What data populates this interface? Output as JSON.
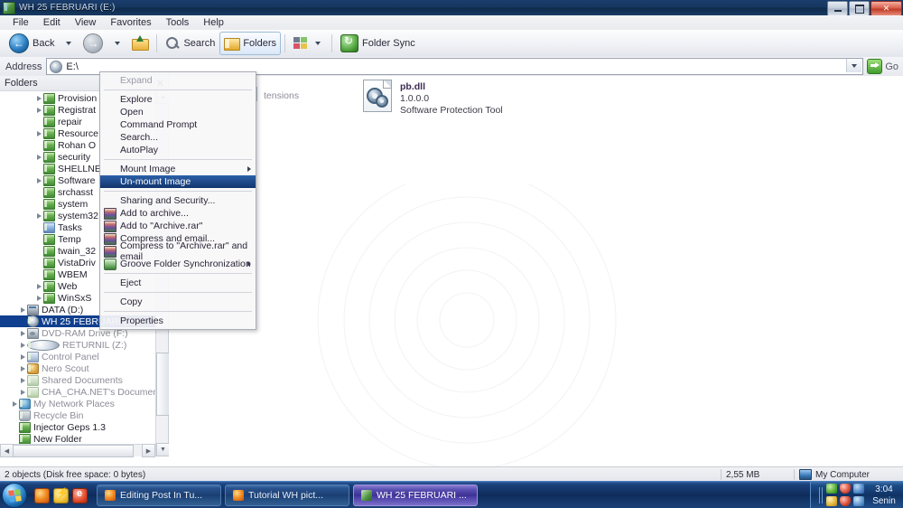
{
  "window": {
    "title": "WH 25 FEBRUARI (E:)",
    "icon": "drive-folder-icon",
    "minimize": "–",
    "maximize": "□",
    "close": "✕"
  },
  "menubar": {
    "items": [
      {
        "label": "File"
      },
      {
        "label": "Edit"
      },
      {
        "label": "View"
      },
      {
        "label": "Favorites"
      },
      {
        "label": "Tools"
      },
      {
        "label": "Help"
      }
    ]
  },
  "toolbar": {
    "back_label": "Back",
    "search_label": "Search",
    "folders_label": "Folders",
    "folder_sync_label": "Folder Sync"
  },
  "address": {
    "label": "Address",
    "value": "E:\\",
    "go_label": "Go"
  },
  "folders_pane": {
    "header": "Folders",
    "close_glyph": "✕",
    "items": [
      {
        "label": "Provision",
        "indent": 4,
        "twisty": true,
        "icon": "folder-icon",
        "dim": false
      },
      {
        "label": "Registrat",
        "indent": 4,
        "twisty": true,
        "icon": "folder-icon",
        "dim": false
      },
      {
        "label": "repair",
        "indent": 4,
        "twisty": false,
        "icon": "folder-icon",
        "dim": false
      },
      {
        "label": "Resource",
        "indent": 4,
        "twisty": true,
        "icon": "folder-icon",
        "dim": false
      },
      {
        "label": "Rohan O",
        "indent": 4,
        "twisty": false,
        "icon": "folder-icon",
        "dim": false
      },
      {
        "label": "security",
        "indent": 4,
        "twisty": true,
        "icon": "folder-icon",
        "dim": false
      },
      {
        "label": "SHELLNE",
        "indent": 4,
        "twisty": false,
        "icon": "folder-icon",
        "dim": false
      },
      {
        "label": "Software",
        "indent": 4,
        "twisty": true,
        "icon": "folder-icon",
        "dim": false
      },
      {
        "label": "srchasst",
        "indent": 4,
        "twisty": false,
        "icon": "folder-icon",
        "dim": false
      },
      {
        "label": "system",
        "indent": 4,
        "twisty": false,
        "icon": "folder-icon",
        "dim": false
      },
      {
        "label": "system32",
        "indent": 4,
        "twisty": true,
        "icon": "folder-icon",
        "dim": false
      },
      {
        "label": "Tasks",
        "indent": 4,
        "twisty": false,
        "icon": "folder-blue-icon",
        "dim": false
      },
      {
        "label": "Temp",
        "indent": 4,
        "twisty": false,
        "icon": "folder-icon",
        "dim": false
      },
      {
        "label": "twain_32",
        "indent": 4,
        "twisty": false,
        "icon": "folder-icon",
        "dim": false
      },
      {
        "label": "VistaDriv",
        "indent": 4,
        "twisty": false,
        "icon": "folder-icon",
        "dim": false
      },
      {
        "label": "WBEM",
        "indent": 4,
        "twisty": false,
        "icon": "folder-icon",
        "dim": false
      },
      {
        "label": "Web",
        "indent": 4,
        "twisty": true,
        "icon": "folder-icon",
        "dim": false
      },
      {
        "label": "WinSxS",
        "indent": 4,
        "twisty": true,
        "icon": "folder-icon",
        "dim": false
      },
      {
        "label": "DATA (D:)",
        "indent": 2,
        "twisty": true,
        "icon": "hard-drive-icon",
        "dim": false
      },
      {
        "label": "WH 25 FEBRUARI (E:)",
        "indent": 2,
        "twisty": false,
        "icon": "disc-drive-icon",
        "dim": false,
        "selected": true
      },
      {
        "label": "DVD-RAM Drive (F:)",
        "indent": 2,
        "twisty": true,
        "icon": "dvd-drive-icon",
        "dim": true
      },
      {
        "label": "RETURNIL (Z:)",
        "indent": 2,
        "twisty": true,
        "icon": "clock-drive-icon",
        "dim": true
      },
      {
        "label": "Control Panel",
        "indent": 2,
        "twisty": true,
        "icon": "control-panel-icon",
        "dim": true
      },
      {
        "label": "Nero Scout",
        "indent": 2,
        "twisty": true,
        "icon": "nero-scout-icon",
        "dim": true
      },
      {
        "label": "Shared Documents",
        "indent": 2,
        "twisty": true,
        "icon": "folder-pale-icon",
        "dim": true
      },
      {
        "label": "CHA_CHA.NET's Documents",
        "indent": 2,
        "twisty": true,
        "icon": "folder-pale-icon",
        "dim": true
      },
      {
        "label": "My Network Places",
        "indent": 1,
        "twisty": true,
        "icon": "network-icon",
        "dim": true
      },
      {
        "label": "Recycle Bin",
        "indent": 1,
        "twisty": false,
        "icon": "recycle-bin-icon",
        "dim": true
      },
      {
        "label": "Injector Geps 1.3",
        "indent": 1,
        "twisty": false,
        "icon": "folder-icon",
        "dim": false
      },
      {
        "label": "New Folder",
        "indent": 1,
        "twisty": false,
        "icon": "folder-icon",
        "dim": false
      }
    ]
  },
  "content": {
    "column_header_partial": "tensions",
    "file": {
      "name": "pb.dll",
      "version": "1.0.0.0",
      "description": "Software Protection Tool",
      "icon": "dll-gear-icon"
    }
  },
  "context_menu": {
    "items": [
      {
        "label": "Expand",
        "state": "disabled"
      },
      {
        "type": "separator"
      },
      {
        "label": "Explore",
        "state": "normal"
      },
      {
        "label": "Open",
        "state": "normal"
      },
      {
        "label": "Command Prompt",
        "state": "normal"
      },
      {
        "label": "Search...",
        "state": "normal"
      },
      {
        "label": "AutoPlay",
        "state": "normal"
      },
      {
        "type": "separator"
      },
      {
        "label": "Mount Image",
        "state": "normal",
        "submenu": true
      },
      {
        "label": "Un-mount Image",
        "state": "highlight"
      },
      {
        "type": "separator"
      },
      {
        "label": "Sharing and Security...",
        "state": "normal"
      },
      {
        "label": "Add to archive...",
        "state": "normal",
        "icon": "winrar-icon"
      },
      {
        "label": "Add to \"Archive.rar\"",
        "state": "normal",
        "icon": "winrar-icon"
      },
      {
        "label": "Compress and email...",
        "state": "normal",
        "icon": "winrar-icon"
      },
      {
        "label": "Compress to \"Archive.rar\" and email",
        "state": "normal",
        "icon": "winrar-icon"
      },
      {
        "label": "Groove Folder Synchronization",
        "state": "normal",
        "icon": "groove-icon",
        "submenu": true
      },
      {
        "type": "separator"
      },
      {
        "label": "Eject",
        "state": "normal"
      },
      {
        "type": "separator"
      },
      {
        "label": "Copy",
        "state": "normal"
      },
      {
        "type": "separator"
      },
      {
        "label": "Properties",
        "state": "normal"
      }
    ]
  },
  "statusbar": {
    "objects": "2 objects (Disk free space: 0 bytes)",
    "size": "2,55 MB",
    "location": "My Computer"
  },
  "taskbar": {
    "start_label": "Start",
    "quick_launch": [
      {
        "name": "firefox-icon"
      },
      {
        "name": "bolt-icon"
      },
      {
        "name": "red-e-icon"
      }
    ],
    "tasks": [
      {
        "label": "Editing Post In Tu...",
        "icon": "firefox-icon",
        "active": false
      },
      {
        "label": "Tutorial WH pict...",
        "icon": "firefox-icon",
        "active": false
      },
      {
        "label": "WH 25 FEBRUARI ...",
        "icon": "explorer-icon",
        "active": true
      }
    ],
    "tray": {
      "icons": [
        "green-sync-icon",
        "shield-red-icon",
        "blue-network-icon",
        "gold-shield-icon",
        "red-alert-icon",
        "speaker-icon"
      ],
      "time": "3:04",
      "day": "Senin"
    }
  },
  "colors": {
    "titlebar": "#16375f",
    "selection": "#0f3f8e",
    "menu_highlight": "#1b4380",
    "taskbar": "#12305f",
    "active_task": "#4539a2"
  }
}
